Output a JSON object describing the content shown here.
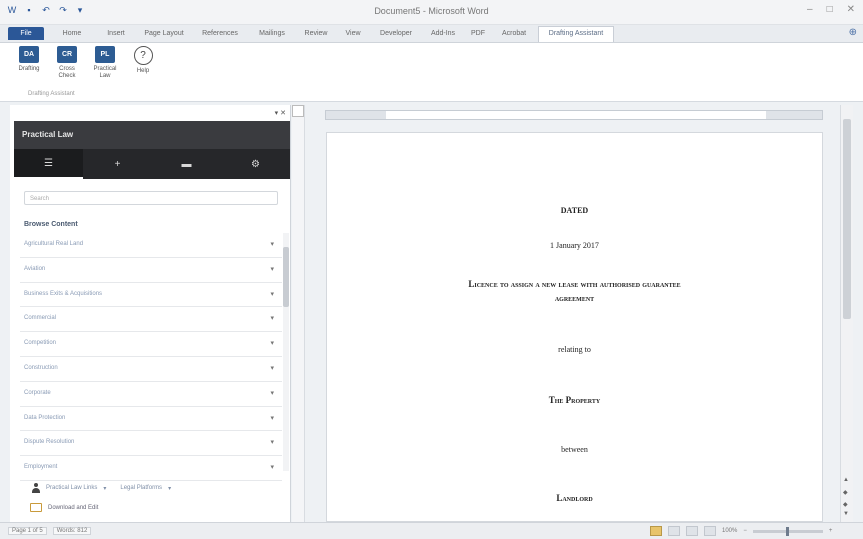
{
  "window": {
    "title": "Document5 - Microsoft Word"
  },
  "qat": {
    "icons": [
      "word-icon",
      "save-icon",
      "undo-icon",
      "redo-icon",
      "customize-icon"
    ]
  },
  "ribbon_tabs": [
    {
      "label": "File"
    },
    {
      "label": "Home"
    },
    {
      "label": "Insert"
    },
    {
      "label": "Page Layout"
    },
    {
      "label": "References"
    },
    {
      "label": "Mailings"
    },
    {
      "label": "Review"
    },
    {
      "label": "View"
    },
    {
      "label": "Developer"
    },
    {
      "label": "Add-Ins"
    },
    {
      "label": "PDF"
    },
    {
      "label": "Acrobat"
    },
    {
      "label": "Drafting Assistant"
    }
  ],
  "ribbon": {
    "buttons": [
      {
        "label": "Drafting",
        "icon_text": "DA"
      },
      {
        "label": "Cross Check",
        "icon_text": "CR"
      },
      {
        "label": "Practical Law",
        "icon_text": "PL"
      },
      {
        "label": "Help",
        "icon_text": "?"
      }
    ],
    "group_label": "Drafting Assistant"
  },
  "pane": {
    "title": "Practical Law",
    "tab_icons": [
      "list-icon",
      "plus-icon",
      "folder-icon",
      "gear-icon"
    ],
    "search_placeholder": "Search",
    "browse_heading": "Browse Content",
    "items": [
      {
        "label": "Agricultural Real Land"
      },
      {
        "label": "Aviation"
      },
      {
        "label": "Business Exits & Acquisitions"
      },
      {
        "label": "Commercial"
      },
      {
        "label": "Competition"
      },
      {
        "label": "Construction"
      },
      {
        "label": "Corporate"
      },
      {
        "label": "Data Protection"
      },
      {
        "label": "Dispute Resolution"
      },
      {
        "label": "Employment"
      }
    ],
    "footer": {
      "user_label": "Practical Law Links",
      "legal_label": "Legal Platforms",
      "download_label": "Download and Edit"
    }
  },
  "document": {
    "dated": "DATED",
    "date": "1 January 2017",
    "title_line1": "Licence to assign a new lease with authorised guarantee",
    "title_line2": "agreement",
    "relating": "relating to",
    "property": "The Property",
    "between": "between",
    "landlord": "Landlord"
  },
  "status": {
    "page": "Page 1 of 5",
    "words": "Words: 812",
    "zoom": "100%"
  }
}
